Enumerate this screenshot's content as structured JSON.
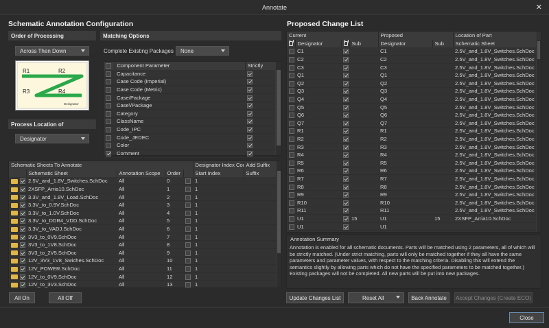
{
  "window": {
    "title": "Annotate",
    "close": "✕"
  },
  "left": {
    "title": "Schematic Annotation Configuration",
    "order": {
      "header": "Order of Processing",
      "selected": "Across Then Down"
    },
    "matching": {
      "header": "Matching Options",
      "complete_label": "Complete Existing Packages",
      "complete_value": "None",
      "col_param": "Component Parameter",
      "col_strict": "Strictly",
      "params": [
        {
          "name": "Capacitance",
          "checked": false,
          "strict": true
        },
        {
          "name": "Case Code (Imperial)",
          "checked": false,
          "strict": true
        },
        {
          "name": "Case Code (Metric)",
          "checked": false,
          "strict": true
        },
        {
          "name": "Case/Package",
          "checked": false,
          "strict": true
        },
        {
          "name": "Case\\/Package",
          "checked": false,
          "strict": true
        },
        {
          "name": "Category",
          "checked": false,
          "strict": true
        },
        {
          "name": "ClassName",
          "checked": false,
          "strict": true
        },
        {
          "name": "Code_IPC",
          "checked": false,
          "strict": true
        },
        {
          "name": "Code_JEDEC",
          "checked": false,
          "strict": true
        },
        {
          "name": "Color",
          "checked": false,
          "strict": true
        },
        {
          "name": "Comment",
          "checked": true,
          "strict": true
        }
      ]
    },
    "diagram": {
      "labels": [
        "R1",
        "R2",
        "R3",
        "R4"
      ],
      "footer": "Designator"
    },
    "location": {
      "header": "Process Location of",
      "selected": "Designator"
    },
    "sheets": {
      "group_headers": [
        "Schematic Sheets To Annotate",
        "Designator Index Cont...",
        "Add Suffix"
      ],
      "cols": [
        "Schematic Sheet",
        "Annotation Scope",
        "Order",
        "Start Index",
        "Suffix"
      ],
      "rows": [
        {
          "name": "2.5V_and_1.8V_Switches.SchDoc",
          "scope": "All",
          "order": "0",
          "start": "1"
        },
        {
          "name": "2XSFP_Arria10.SchDoc",
          "scope": "All",
          "order": "1",
          "start": "1"
        },
        {
          "name": "3.3V_and_1.8V_Load.SchDoc",
          "scope": "All",
          "order": "2",
          "start": "1"
        },
        {
          "name": "3.3V_to_0.9V.SchDoc",
          "scope": "All",
          "order": "3",
          "start": "1"
        },
        {
          "name": "3.3V_to_1.0V.SchDoc",
          "scope": "All",
          "order": "4",
          "start": "1"
        },
        {
          "name": "3.3V_to_DDR4_VDD.SchDoc",
          "scope": "All",
          "order": "5",
          "start": "1"
        },
        {
          "name": "3.3V_to_VADJ.SchDoc",
          "scope": "All",
          "order": "6",
          "start": "1"
        },
        {
          "name": "3V3_to_0V9.SchDoc",
          "scope": "All",
          "order": "7",
          "start": "1"
        },
        {
          "name": "3V3_to_1V8.SchDoc",
          "scope": "All",
          "order": "8",
          "start": "1"
        },
        {
          "name": "3V3_to_2V5.SchDoc",
          "scope": "All",
          "order": "9",
          "start": "1"
        },
        {
          "name": "12V_3V3_1V8_Swiches.SchDoc",
          "scope": "All",
          "order": "10",
          "start": "1"
        },
        {
          "name": "12V_POWER.SchDoc",
          "scope": "All",
          "order": "11",
          "start": "1"
        },
        {
          "name": "12V_to_0V9.SchDoc",
          "scope": "All",
          "order": "12",
          "start": "1"
        },
        {
          "name": "12V_to_3V3.SchDoc",
          "scope": "All",
          "order": "13",
          "start": "1"
        }
      ]
    },
    "all_on": "All On",
    "all_off": "All Off"
  },
  "right": {
    "title": "Proposed Change List",
    "group_headers": [
      "Current",
      "Proposed",
      "Location of Part"
    ],
    "cols": [
      "Designator",
      "Sub",
      "Designator",
      "Sub",
      "Schematic Sheet"
    ],
    "rows": [
      {
        "cur": "C1",
        "csub": "",
        "prop": "C1",
        "psub": "",
        "sheet": "2.5V_and_1.8V_Switches.SchDoc"
      },
      {
        "cur": "C2",
        "csub": "",
        "prop": "C2",
        "psub": "",
        "sheet": "2.5V_and_1.8V_Switches.SchDoc"
      },
      {
        "cur": "C3",
        "csub": "",
        "prop": "C3",
        "psub": "",
        "sheet": "2.5V_and_1.8V_Switches.SchDoc"
      },
      {
        "cur": "Q1",
        "csub": "",
        "prop": "Q1",
        "psub": "",
        "sheet": "2.5V_and_1.8V_Switches.SchDoc"
      },
      {
        "cur": "Q2",
        "csub": "",
        "prop": "Q2",
        "psub": "",
        "sheet": "2.5V_and_1.8V_Switches.SchDoc"
      },
      {
        "cur": "Q3",
        "csub": "",
        "prop": "Q3",
        "psub": "",
        "sheet": "2.5V_and_1.8V_Switches.SchDoc"
      },
      {
        "cur": "Q4",
        "csub": "",
        "prop": "Q4",
        "psub": "",
        "sheet": "2.5V_and_1.8V_Switches.SchDoc"
      },
      {
        "cur": "Q5",
        "csub": "",
        "prop": "Q5",
        "psub": "",
        "sheet": "2.5V_and_1.8V_Switches.SchDoc"
      },
      {
        "cur": "Q6",
        "csub": "",
        "prop": "Q6",
        "psub": "",
        "sheet": "2.5V_and_1.8V_Switches.SchDoc"
      },
      {
        "cur": "Q7",
        "csub": "",
        "prop": "Q7",
        "psub": "",
        "sheet": "2.5V_and_1.8V_Switches.SchDoc"
      },
      {
        "cur": "R1",
        "csub": "",
        "prop": "R1",
        "psub": "",
        "sheet": "2.5V_and_1.8V_Switches.SchDoc"
      },
      {
        "cur": "R2",
        "csub": "",
        "prop": "R2",
        "psub": "",
        "sheet": "2.5V_and_1.8V_Switches.SchDoc"
      },
      {
        "cur": "R3",
        "csub": "",
        "prop": "R3",
        "psub": "",
        "sheet": "2.5V_and_1.8V_Switches.SchDoc"
      },
      {
        "cur": "R4",
        "csub": "",
        "prop": "R4",
        "psub": "",
        "sheet": "2.5V_and_1.8V_Switches.SchDoc"
      },
      {
        "cur": "R5",
        "csub": "",
        "prop": "R5",
        "psub": "",
        "sheet": "2.5V_and_1.8V_Switches.SchDoc"
      },
      {
        "cur": "R6",
        "csub": "",
        "prop": "R6",
        "psub": "",
        "sheet": "2.5V_and_1.8V_Switches.SchDoc"
      },
      {
        "cur": "R7",
        "csub": "",
        "prop": "R7",
        "psub": "",
        "sheet": "2.5V_and_1.8V_Switches.SchDoc"
      },
      {
        "cur": "R8",
        "csub": "",
        "prop": "R8",
        "psub": "",
        "sheet": "2.5V_and_1.8V_Switches.SchDoc"
      },
      {
        "cur": "R9",
        "csub": "",
        "prop": "R9",
        "psub": "",
        "sheet": "2.5V_and_1.8V_Switches.SchDoc"
      },
      {
        "cur": "R10",
        "csub": "",
        "prop": "R10",
        "psub": "",
        "sheet": "2.5V_and_1.8V_Switches.SchDoc"
      },
      {
        "cur": "R11",
        "csub": "",
        "prop": "R11",
        "psub": "",
        "sheet": "2.5V_and_1.8V_Switches.SchDoc"
      },
      {
        "cur": "U1",
        "csub": "15",
        "prop": "U1",
        "psub": "15",
        "sheet": "2XSFP_Arria10.SchDoc"
      },
      {
        "cur": "U1",
        "csub": "",
        "prop": "U1",
        "psub": "",
        "sheet": ""
      }
    ],
    "summary_title": "Annotation Summary",
    "summary_text": "Annotation is enabled for all schematic documents. Parts will be matched using 2 parameters, all of which will be strictly matched. (Under strict matching, parts will only be matched together if they all have the same parameters and parameter values, with respect to the matching criteria. Disabling this will extend the semantics slightly by allowing parts which do not have the specified parameters to be matched together.) Existing packages will not be completed. All new parts will be put into new packages.",
    "btn_update": "Update Changes List",
    "btn_reset": "Reset All",
    "btn_back": "Back Annotate",
    "btn_accept": "Accept Changes (Create ECO)"
  },
  "close_button": "Close"
}
